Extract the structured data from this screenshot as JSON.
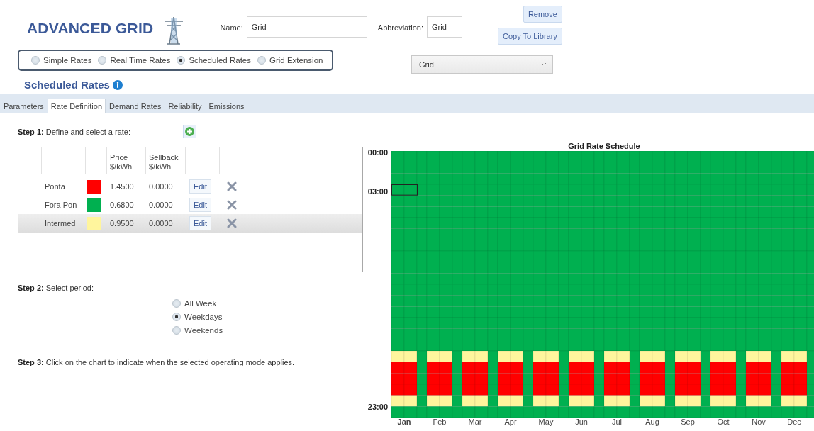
{
  "header": {
    "title": "ADVANCED GRID",
    "name_label": "Name:",
    "name_value": "Grid",
    "abbreviation_label": "Abbreviation:",
    "abbreviation_value": "Grid",
    "buttons": [
      "Remove",
      "Copy To Library"
    ],
    "library_dropdown": "Grid"
  },
  "rate_types": [
    {
      "label": "Simple Rates",
      "selected": false
    },
    {
      "label": "Real Time Rates",
      "selected": false
    },
    {
      "label": "Scheduled Rates",
      "selected": true
    },
    {
      "label": "Grid Extension",
      "selected": false
    }
  ],
  "section_title": "Scheduled Rates",
  "tabs": [
    {
      "label": "Parameters",
      "selected": false
    },
    {
      "label": "Rate Definition",
      "selected": true
    },
    {
      "label": "Demand Rates",
      "selected": false
    },
    {
      "label": "Reliability",
      "selected": false
    },
    {
      "label": "Emissions",
      "selected": false
    }
  ],
  "step1": {
    "lead": "Step 1:",
    "text": "Define and select a rate:"
  },
  "rates_table": {
    "columns": [
      "Price\n$/kWh",
      "Sellback\n$/kWh"
    ],
    "rows": [
      {
        "name": "Ponta",
        "color": "#ff0000",
        "price": "1.4500",
        "sellback": "0.0000",
        "edit": "Edit",
        "selected": false
      },
      {
        "name": "Fora Pon",
        "color": "#00b050",
        "price": "0.6800",
        "sellback": "0.0000",
        "edit": "Edit",
        "selected": false
      },
      {
        "name": "Intermed",
        "color": "#fff59d",
        "price": "0.9500",
        "sellback": "0.0000",
        "edit": "Edit",
        "selected": true
      }
    ]
  },
  "step2": {
    "lead": "Step 2:",
    "text": "Select period:",
    "options": [
      {
        "label": "All Week",
        "selected": false
      },
      {
        "label": "Weekdays",
        "selected": true
      },
      {
        "label": "Weekends",
        "selected": false
      }
    ]
  },
  "step3": {
    "lead": "Step 3:",
    "text": "Click on the chart to indicate when the selected operating mode applies."
  },
  "schedule": {
    "title": "Grid Rate Schedule",
    "months": [
      {
        "label": "Jan",
        "selected": true
      },
      {
        "label": "Feb",
        "selected": false
      },
      {
        "label": "Mar",
        "selected": false
      },
      {
        "label": "Apr",
        "selected": false
      },
      {
        "label": "May",
        "selected": false
      },
      {
        "label": "Jun",
        "selected": false
      },
      {
        "label": "Jul",
        "selected": false
      },
      {
        "label": "Aug",
        "selected": false
      },
      {
        "label": "Sep",
        "selected": false
      },
      {
        "label": "Oct",
        "selected": false
      },
      {
        "label": "Nov",
        "selected": false
      },
      {
        "label": "Dec",
        "selected": false
      }
    ],
    "hours": [
      {
        "label": "00:00",
        "weekday": {
          "color": "#00b050"
        },
        "weekend": {
          "color": "#00b050"
        },
        "focused": false
      },
      {
        "weekday": {
          "color": "#00b050"
        },
        "weekend": {
          "color": "#00b050"
        },
        "focused": false
      },
      {
        "weekday": {
          "color": "#00b050"
        },
        "weekend": {
          "color": "#00b050"
        },
        "focused": false
      },
      {
        "label": "03:00",
        "weekday": {
          "color": "#00b050"
        },
        "weekend": {
          "color": "#00b050"
        },
        "focused": true
      },
      {
        "weekday": {
          "color": "#00b050"
        },
        "weekend": {
          "color": "#00b050"
        },
        "focused": false
      },
      {
        "weekday": {
          "color": "#00b050"
        },
        "weekend": {
          "color": "#00b050"
        },
        "focused": false
      },
      {
        "weekday": {
          "color": "#00b050"
        },
        "weekend": {
          "color": "#00b050"
        },
        "focused": false
      },
      {
        "weekday": {
          "color": "#00b050"
        },
        "weekend": {
          "color": "#00b050"
        },
        "focused": false
      },
      {
        "weekday": {
          "color": "#00b050"
        },
        "weekend": {
          "color": "#00b050"
        },
        "focused": false
      },
      {
        "weekday": {
          "color": "#00b050"
        },
        "weekend": {
          "color": "#00b050"
        },
        "focused": false
      },
      {
        "weekday": {
          "color": "#00b050"
        },
        "weekend": {
          "color": "#00b050"
        },
        "focused": false
      },
      {
        "weekday": {
          "color": "#00b050"
        },
        "weekend": {
          "color": "#00b050"
        },
        "focused": false
      },
      {
        "weekday": {
          "color": "#00b050"
        },
        "weekend": {
          "color": "#00b050"
        },
        "focused": false
      },
      {
        "weekday": {
          "color": "#00b050"
        },
        "weekend": {
          "color": "#00b050"
        },
        "focused": false
      },
      {
        "weekday": {
          "color": "#00b050"
        },
        "weekend": {
          "color": "#00b050"
        },
        "focused": false
      },
      {
        "weekday": {
          "color": "#00b050"
        },
        "weekend": {
          "color": "#00b050"
        },
        "focused": false
      },
      {
        "weekday": {
          "color": "#00b050"
        },
        "weekend": {
          "color": "#00b050"
        },
        "focused": false
      },
      {
        "weekday": {
          "color": "#00b050"
        },
        "weekend": {
          "color": "#00b050"
        },
        "focused": false
      },
      {
        "weekday": {
          "color": "#fff59d"
        },
        "weekend": {
          "color": "#00b050"
        },
        "focused": false
      },
      {
        "weekday": {
          "color": "#ff0000"
        },
        "weekend": {
          "color": "#00b050"
        },
        "focused": false
      },
      {
        "weekday": {
          "color": "#ff0000"
        },
        "weekend": {
          "color": "#00b050"
        },
        "focused": false
      },
      {
        "weekday": {
          "color": "#ff0000"
        },
        "weekend": {
          "color": "#00b050"
        },
        "focused": false
      },
      {
        "weekday": {
          "color": "#fff59d"
        },
        "weekend": {
          "color": "#00b050"
        },
        "focused": false
      },
      {
        "label": "23:00",
        "weekday": {
          "color": "#00b050"
        },
        "weekend": {
          "color": "#00b050"
        },
        "focused": false
      }
    ]
  }
}
